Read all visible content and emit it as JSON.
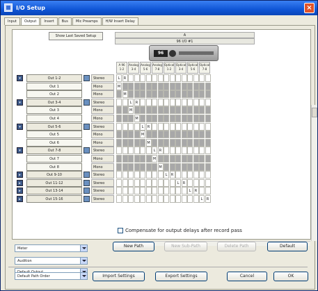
{
  "window": {
    "title": "I/O Setup",
    "close_label": "×"
  },
  "tabs": [
    "Input",
    "Output",
    "Insert",
    "Bus",
    "Mic Preamps",
    "H/W Insert Delay"
  ],
  "active_tab": "Output",
  "show_last_saved": "Show Last Saved Setup",
  "device": {
    "column_letter": "A",
    "name": "96 I/O #1",
    "display": "96"
  },
  "columns": [
    {
      "top": "A 96",
      "bottom": "1-2"
    },
    {
      "top": "Analog",
      "bottom": "3-4"
    },
    {
      "top": "Analog",
      "bottom": "5-6"
    },
    {
      "top": "Analog",
      "bottom": "7-8"
    },
    {
      "top": "Optical",
      "bottom": "1-2"
    },
    {
      "top": "Optical",
      "bottom": "3-4"
    },
    {
      "top": "Optical",
      "bottom": "5-6"
    },
    {
      "top": "Optical",
      "bottom": "7-8"
    }
  ],
  "paths": [
    {
      "name": "Out 1-2",
      "format": "Stereo",
      "main": true
    },
    {
      "name": "Out 1",
      "format": "Mono",
      "main": false
    },
    {
      "name": "Out 2",
      "format": "Mono",
      "main": false
    },
    {
      "name": "Out 3-4",
      "format": "Stereo",
      "main": true
    },
    {
      "name": "Out 3",
      "format": "Mono",
      "main": false
    },
    {
      "name": "Out 4",
      "format": "Mono",
      "main": false
    },
    {
      "name": "Out 5-6",
      "format": "Stereo",
      "main": true
    },
    {
      "name": "Out 5",
      "format": "Mono",
      "main": false
    },
    {
      "name": "Out 6",
      "format": "Mono",
      "main": false
    },
    {
      "name": "Out 7-8",
      "format": "Stereo",
      "main": true
    },
    {
      "name": "Out 7",
      "format": "Mono",
      "main": false
    },
    {
      "name": "Out 8",
      "format": "Mono",
      "main": false
    },
    {
      "name": "Out 9-10",
      "format": "Stereo",
      "main": true
    },
    {
      "name": "Out 11-12",
      "format": "Stereo",
      "main": true
    },
    {
      "name": "Out 13-14",
      "format": "Stereo",
      "main": true
    },
    {
      "name": "Out 15-16",
      "format": "Stereo",
      "main": true
    }
  ],
  "assignments": [
    {
      "L": 0,
      "R": 1
    },
    {
      "M": 0
    },
    {
      "M": 1
    },
    {
      "L": 2,
      "R": 3
    },
    {
      "M": 2
    },
    {
      "M": 3
    },
    {
      "L": 4,
      "R": 5
    },
    {
      "M": 4
    },
    {
      "M": 5
    },
    {
      "L": 6,
      "R": 7
    },
    {
      "M": 6
    },
    {
      "M": 7
    },
    {
      "L": 8,
      "R": 9
    },
    {
      "L": 10,
      "R": 11
    },
    {
      "L": 12,
      "R": 13
    },
    {
      "L": 14,
      "R": 15
    }
  ],
  "controls": {
    "meter": "Meter",
    "audition": "Audition",
    "default_output": "Default Output",
    "default_path_order": "Default Path Order",
    "compensate_label": "Compensate for output delays after record pass",
    "new_path": "New Path",
    "new_sub_path": "New Sub-Path",
    "delete_path": "Delete Path",
    "default": "Default",
    "import_settings": "Import Settings",
    "export_settings": "Export Settings",
    "cancel": "Cancel",
    "ok": "OK"
  }
}
